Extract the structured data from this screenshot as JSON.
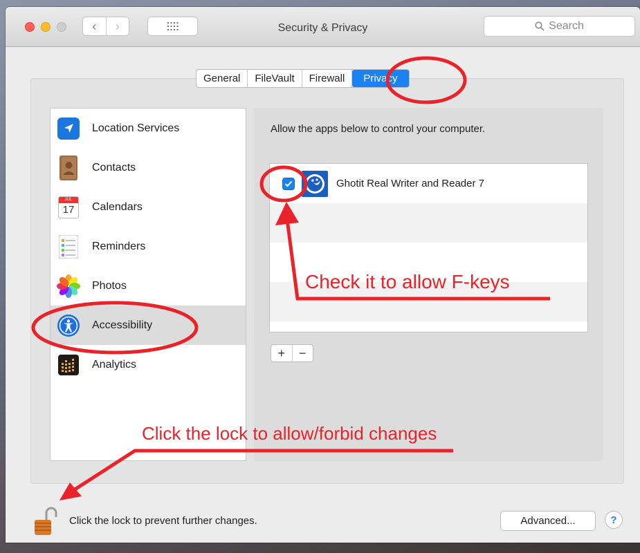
{
  "window": {
    "title": "Security & Privacy",
    "search_placeholder": "Search"
  },
  "tabs": [
    {
      "label": "General",
      "active": false
    },
    {
      "label": "FileVault",
      "active": false
    },
    {
      "label": "Firewall",
      "active": false
    },
    {
      "label": "Privacy",
      "active": true
    }
  ],
  "sidebar": {
    "items": [
      {
        "label": "Location Services",
        "icon": "location-arrow-icon",
        "selected": false
      },
      {
        "label": "Contacts",
        "icon": "contacts-book-icon",
        "selected": false
      },
      {
        "label": "Calendars",
        "icon": "calendar-icon",
        "selected": false
      },
      {
        "label": "Reminders",
        "icon": "reminders-list-icon",
        "selected": false
      },
      {
        "label": "Photos",
        "icon": "photos-flower-icon",
        "selected": false
      },
      {
        "label": "Accessibility",
        "icon": "accessibility-icon",
        "selected": true
      },
      {
        "label": "Analytics",
        "icon": "analytics-grid-icon",
        "selected": false
      }
    ]
  },
  "calendar_icon": {
    "month": "JUL",
    "day": "17"
  },
  "main": {
    "allow_text": "Allow the apps below to control your computer.",
    "apps": [
      {
        "name": "Ghotit Real Writer and Reader 7",
        "checked": true
      }
    ],
    "add_label": "+",
    "remove_label": "−"
  },
  "footer": {
    "lock_text": "Click the lock to prevent further changes.",
    "advanced_label": "Advanced...",
    "help_label": "?"
  },
  "annotations": {
    "check_note": "Check it to allow F-keys",
    "lock_note": "Click the lock to allow/forbid changes",
    "color": "#e8232a"
  },
  "colors": {
    "accent": "#1b82f2"
  }
}
